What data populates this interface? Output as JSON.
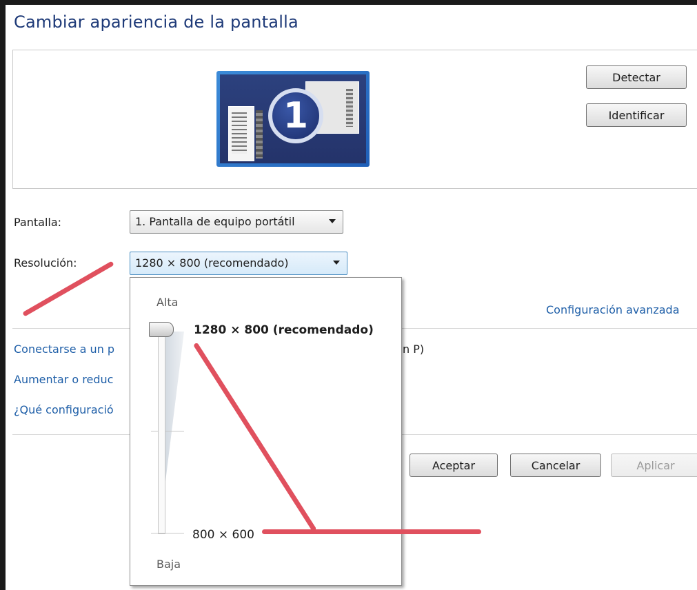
{
  "window": {
    "title": "Cambiar apariencia de la pantalla"
  },
  "monitor": {
    "number": "1"
  },
  "buttons": {
    "detect": "Detectar",
    "identify": "Identificar",
    "accept": "Aceptar",
    "cancel": "Cancelar",
    "apply": "Aplicar"
  },
  "settings": {
    "display_label": "Pantalla:",
    "display_value": "1. Pantalla de equipo portátil",
    "resolution_label": "Resolución:",
    "resolution_value": "1280 × 800 (recomendado)"
  },
  "links": {
    "advanced": "Configuración avanzada",
    "connect_partial": "Conectarse a un p",
    "connect_suffix": "n P)",
    "resize_partial": "Aumentar o reduc",
    "which_partial": "¿Qué configuració"
  },
  "resolution_dropdown": {
    "high_label": "Alta",
    "low_label": "Baja",
    "max_option": "1280 × 800 (recomendado)",
    "min_option": "800 × 600",
    "slider_position": 1.0
  },
  "colors": {
    "title": "#1e3a78",
    "link": "#1f5fa8",
    "annotation": "#e0505e"
  }
}
